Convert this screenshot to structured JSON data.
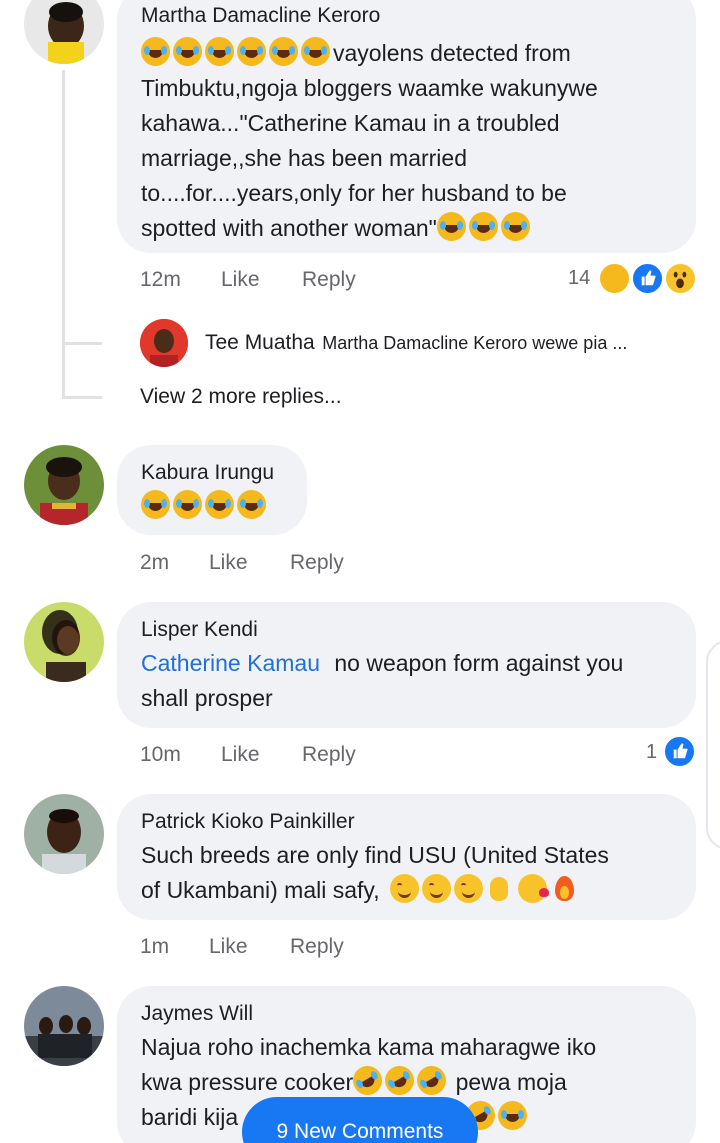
{
  "comments": [
    {
      "name": "Martha Damacline Keroro",
      "line1": "vayolens detected from",
      "line2": "Timbuktu,ngoja bloggers waamke wakunywe",
      "line3": "kahawa...\"Catherine Kamau in a troubled",
      "line4": "marriage,,she has been married",
      "line5": "to....for....years,only for her husband to be",
      "line6": "spotted with another woman\"",
      "time": "12m",
      "like": "Like",
      "reply": "Reply",
      "reaction_count": "14"
    },
    {
      "name": "Kabura Irungu",
      "time": "2m",
      "like": "Like",
      "reply": "Reply"
    },
    {
      "name": "Lisper Kendi",
      "mention": "Catherine Kamau",
      "line1": " no weapon form against you",
      "line2": "shall prosper",
      "time": "10m",
      "like": "Like",
      "reply": "Reply",
      "reaction_count": "1"
    },
    {
      "name": "Patrick Kioko Painkiller",
      "line1": "Such breeds are only find USU (United States",
      "line2": "of Ukambani) mali safy,",
      "time": "1m",
      "like": "Like",
      "reply": "Reply"
    },
    {
      "name": "Jaymes Will",
      "line1": "Najua roho inachemka kama maharagwe iko",
      "line2": "kwa pressure cooker",
      "line2b": " pewa moja",
      "line3": "baridi kija"
    }
  ],
  "reply_preview": {
    "name": "Tee Muatha",
    "text": "Martha Damacline Keroro wewe pia ..."
  },
  "view_more": "View 2 more replies...",
  "new_comments_button": "9 New Comments",
  "colors": {
    "bubble": "#f0f2f5",
    "mention": "#216fdb",
    "meta": "#65676b",
    "button": "#1877f2"
  }
}
